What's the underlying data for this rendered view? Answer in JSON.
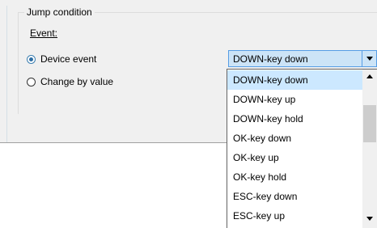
{
  "group": {
    "title": "Jump condition"
  },
  "event_label": "Event:",
  "radios": [
    {
      "label": "Device event",
      "checked": true
    },
    {
      "label": "Change by value",
      "checked": false
    }
  ],
  "combo": {
    "selected": "DOWN-key down"
  },
  "dropdown": {
    "items": [
      "DOWN-key down",
      "DOWN-key up",
      "DOWN-key hold",
      "OK-key down",
      "OK-key up",
      "OK-key hold",
      "ESC-key down",
      "ESC-key up"
    ],
    "selected_index": 0
  },
  "colors": {
    "selection": "#cce8ff",
    "combo_focus": "#cce4f7",
    "focus_border": "#569de5"
  }
}
